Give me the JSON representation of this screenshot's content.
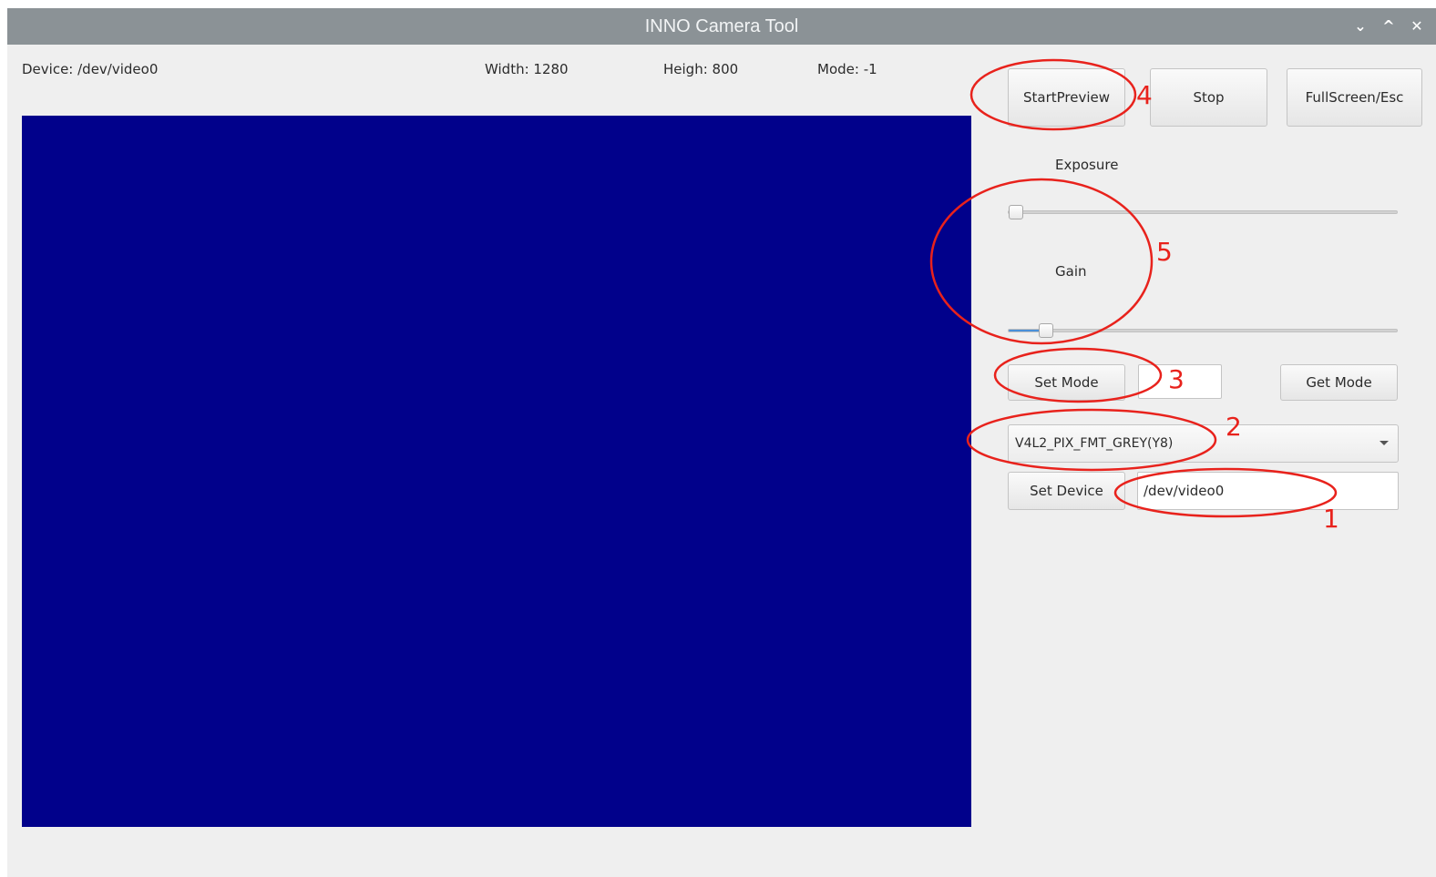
{
  "window": {
    "title": "INNO Camera Tool",
    "controls": {
      "minimize_icon": "⌄",
      "maximize_icon": "^",
      "close_icon": "✕"
    }
  },
  "info": {
    "device": "Device: /dev/video0",
    "width": "Width: 1280",
    "height": "Heigh: 800",
    "mode": "Mode: -1"
  },
  "colors": {
    "preview_bg": "#01018b",
    "titlebar": "#8b9296",
    "annotation": "#e8221c"
  },
  "buttons": {
    "start_preview": "StartPreview",
    "stop": "Stop",
    "fullscreen": "FullScreen/Esc",
    "set_mode": "Set Mode",
    "get_mode": "Get Mode",
    "set_device": "Set Device"
  },
  "exposure": {
    "label": "Exposure",
    "value_fraction": 0.0
  },
  "gain": {
    "label": "Gain",
    "value_fraction": 0.08
  },
  "mode_input": {
    "value": ""
  },
  "format_select": {
    "selected": "V4L2_PIX_FMT_GREY(Y8)"
  },
  "device_input": {
    "value": "/dev/video0"
  },
  "annotations": {
    "n1": "1",
    "n2": "2",
    "n3": "3",
    "n4": "4",
    "n5": "5"
  }
}
